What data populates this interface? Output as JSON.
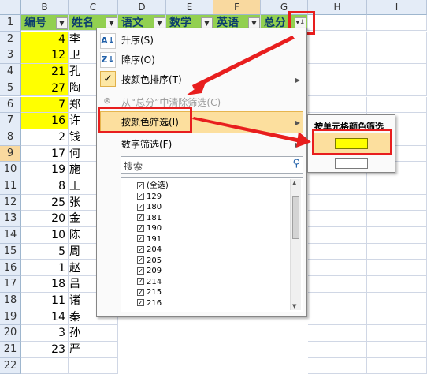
{
  "columns": [
    "B",
    "C",
    "D",
    "E",
    "F",
    "G",
    "H",
    "I"
  ],
  "rows": [
    "1",
    "2",
    "3",
    "4",
    "5",
    "6",
    "7",
    "8",
    "9",
    "10",
    "11",
    "12",
    "13",
    "14",
    "15",
    "16",
    "17",
    "18",
    "19",
    "20",
    "21",
    "22"
  ],
  "header_cells": [
    "编号",
    "姓名",
    "语文",
    "数学",
    "英语",
    "总分"
  ],
  "data_rows": [
    {
      "id": "4",
      "name": "李"
    },
    {
      "id": "12",
      "name": "卫"
    },
    {
      "id": "21",
      "name": "孔"
    },
    {
      "id": "27",
      "name": "陶"
    },
    {
      "id": "7",
      "name": "郑"
    },
    {
      "id": "16",
      "name": "许"
    },
    {
      "id": "2",
      "name": "钱"
    },
    {
      "id": "17",
      "name": "何"
    },
    {
      "id": "19",
      "name": "施"
    },
    {
      "id": "8",
      "name": "王"
    },
    {
      "id": "25",
      "name": "张"
    },
    {
      "id": "20",
      "name": "金"
    },
    {
      "id": "10",
      "name": "陈"
    },
    {
      "id": "5",
      "name": "周"
    },
    {
      "id": "1",
      "name": "赵"
    },
    {
      "id": "18",
      "name": "吕"
    },
    {
      "id": "11",
      "name": "诸"
    },
    {
      "id": "14",
      "name": "秦"
    },
    {
      "id": "3",
      "name": "孙"
    },
    {
      "id": "23",
      "name": "严"
    },
    {
      "id": "",
      "name": ""
    }
  ],
  "colors": {
    "header_green": "#92d050",
    "highlight_yellow": "#ffff00",
    "annotation_red": "#e81e1e"
  },
  "menu": {
    "sort_asc": "升序(S)",
    "sort_desc": "降序(O)",
    "sort_by_color": "按颜色排序(T)",
    "clear_filter": "从“总分”中清除筛选(C)",
    "filter_by_color": "按颜色筛选(I)",
    "number_filter": "数字筛选(F)",
    "search_placeholder": "搜索",
    "checklist": [
      "(全选)",
      "129",
      "180",
      "181",
      "190",
      "191",
      "204",
      "205",
      "209",
      "214",
      "215",
      "216"
    ]
  },
  "submenu": {
    "title": "按单元格颜色筛选",
    "colors": [
      "#ffff00",
      "#ffffff"
    ]
  }
}
